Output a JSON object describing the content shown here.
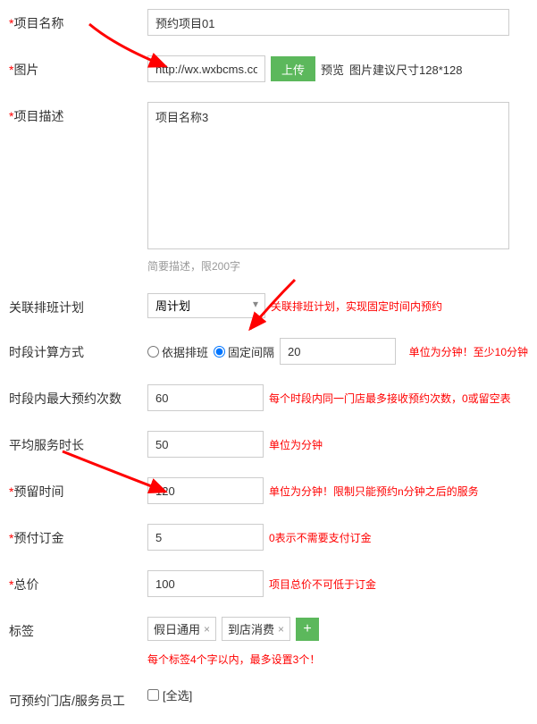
{
  "fields": {
    "project_name": {
      "label": "项目名称",
      "value": "预约项目01"
    },
    "image": {
      "label": "图片",
      "value": "http://wx.wxbcms.com,",
      "upload_btn": "上传",
      "preview": "预览",
      "hint": "图片建议尺寸128*128"
    },
    "description": {
      "label": "项目描述",
      "value": "项目名称3",
      "hint": "简要描述，限200字"
    },
    "schedule": {
      "label": "关联排班计划",
      "selected": "周计划",
      "hint": "关联排班计划，实现固定时间内预约"
    },
    "interval_mode": {
      "label": "时段计算方式",
      "options": {
        "by_schedule": "依据排班",
        "fixed": "固定间隔"
      },
      "value": "20",
      "hint": "单位为分钟！至少10分钟"
    },
    "max_times": {
      "label": "时段内最大预约次数",
      "value": "60",
      "hint": "每个时段内同一门店最多接收预约次数，0或留空表"
    },
    "avg_duration": {
      "label": "平均服务时长",
      "value": "50",
      "hint": "单位为分钟"
    },
    "reserve_time": {
      "label": "预留时间",
      "value": "120",
      "hint": "单位为分钟！限制只能预约n分钟之后的服务"
    },
    "deposit": {
      "label": "预付订金",
      "value": "5",
      "hint": "0表示不需要支付订金"
    },
    "total": {
      "label": "总价",
      "value": "100",
      "hint": "项目总价不可低于订金"
    },
    "tags": {
      "label": "标签",
      "items": [
        "假日通用",
        "到店消费"
      ],
      "hint": "每个标签4个字以内，最多设置3个！"
    },
    "stores": {
      "label": "可预约门店/服务员工",
      "select_all": "[全选]"
    }
  }
}
